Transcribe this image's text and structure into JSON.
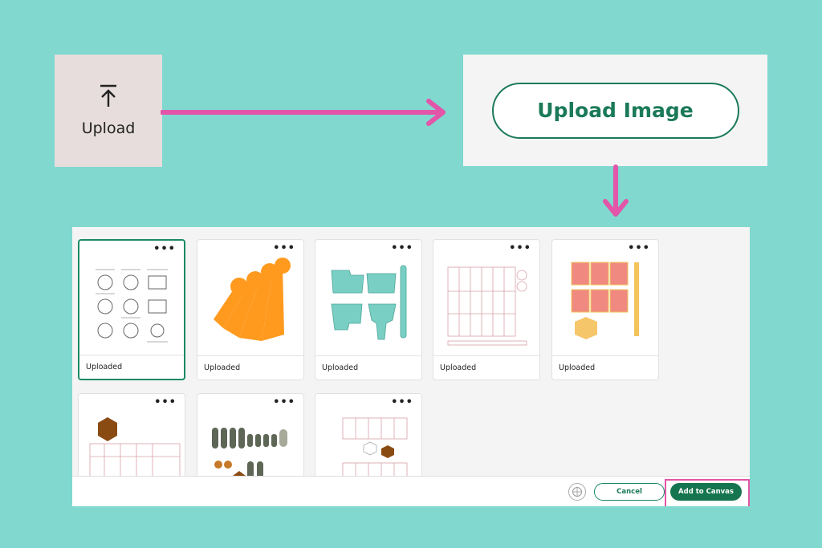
{
  "upload_tile": {
    "label": "Upload",
    "icon": "upload-arrow-icon"
  },
  "upload_image_button": {
    "label": "Upload Image"
  },
  "library": {
    "cards": [
      {
        "caption": "Uploaded",
        "selected": true
      },
      {
        "caption": "Uploaded",
        "selected": false
      },
      {
        "caption": "Uploaded",
        "selected": false
      },
      {
        "caption": "Uploaded",
        "selected": false
      },
      {
        "caption": "Uploaded",
        "selected": false
      },
      {
        "caption": "",
        "selected": false
      },
      {
        "caption": "",
        "selected": false
      },
      {
        "caption": "",
        "selected": false
      }
    ],
    "more_label": "•••"
  },
  "footer": {
    "cancel_label": "Cancel",
    "add_label": "Add to Canvas",
    "help_icon": "help-icon"
  },
  "colors": {
    "background": "#80d8cf",
    "accent_green": "#15754f",
    "arrow_pink": "#e255a8"
  }
}
